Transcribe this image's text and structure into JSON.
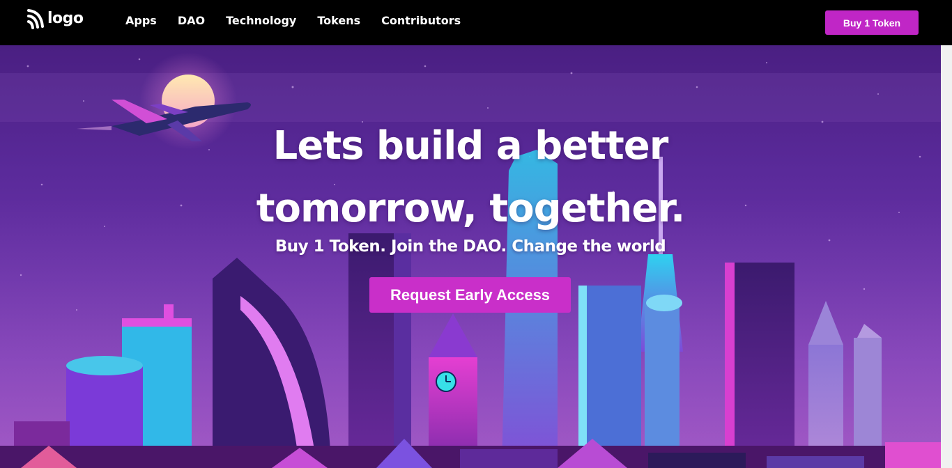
{
  "nav": {
    "logo_text": "logo",
    "logo_icon": "wifi-signal-icon",
    "links": [
      {
        "label": "Apps"
      },
      {
        "label": "DAO"
      },
      {
        "label": "Technology"
      },
      {
        "label": "Tokens"
      },
      {
        "label": "Contributors"
      }
    ],
    "cta_label": "Buy 1 Token"
  },
  "hero": {
    "title_line1": "Lets build a better",
    "title_line2": "tomorrow, together.",
    "subtitle": "Buy 1 Token. Join the DAO. Change the world",
    "cta_label": "Request Early Access"
  },
  "colors": {
    "accent": "#c026c6",
    "nav_bg": "#000000",
    "hero_sky": "#5a2a9a"
  }
}
